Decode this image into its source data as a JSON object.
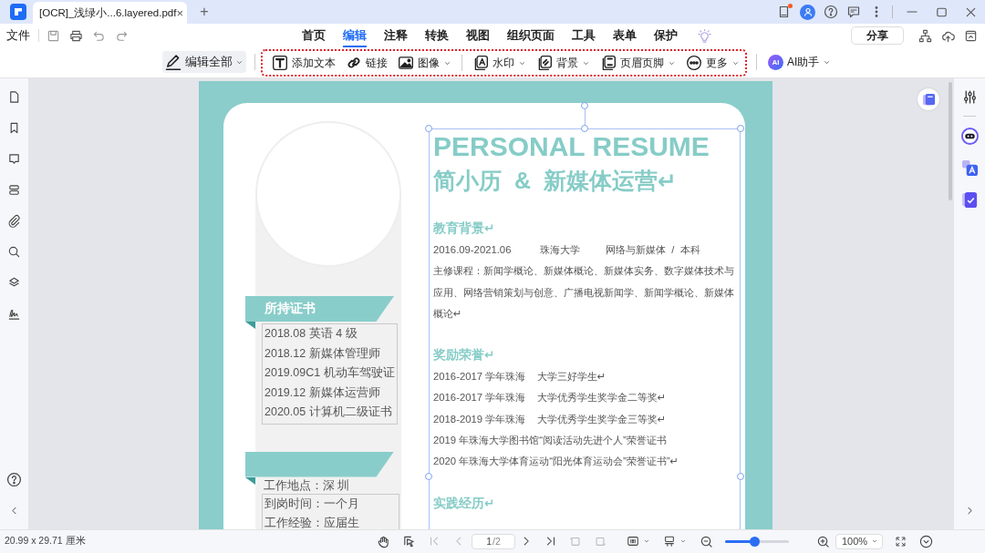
{
  "tab": {
    "title": "[OCR]_浅绿小...6.layered.pdf",
    "close": "×",
    "new_tab": "+"
  },
  "menu": {
    "file": "文件",
    "nav": [
      {
        "label": "首页",
        "selected": false
      },
      {
        "label": "编辑",
        "selected": true
      },
      {
        "label": "注释",
        "selected": false
      },
      {
        "label": "转换",
        "selected": false
      },
      {
        "label": "视图",
        "selected": false
      },
      {
        "label": "组织页面",
        "selected": false
      },
      {
        "label": "工具",
        "selected": false
      },
      {
        "label": "表单",
        "selected": false
      },
      {
        "label": "保护",
        "selected": false
      }
    ],
    "share": "分享"
  },
  "toolbar": {
    "edit_all": "编辑全部",
    "tools": [
      {
        "label": "添加文本",
        "kind": "text",
        "dropdown": false
      },
      {
        "label": "链接",
        "kind": "link",
        "dropdown": false
      },
      {
        "label": "图像",
        "kind": "image",
        "dropdown": true
      },
      {
        "label": "水印",
        "kind": "watermark",
        "dropdown": true
      },
      {
        "label": "背景",
        "kind": "background",
        "dropdown": true
      },
      {
        "label": "页眉页脚",
        "kind": "header",
        "dropdown": true
      },
      {
        "label": "更多",
        "kind": "more",
        "dropdown": true
      }
    ],
    "ai_badge": "AI",
    "ai_label": "AI助手"
  },
  "document": {
    "title": "PERSONAL RESUME",
    "subtitle": "简小历  &  新媒体运营↵",
    "sections": [
      {
        "heading": "教育背景↵",
        "lines": [
          "2016.09-2021.06          珠海大学         网络与新媒体  /  本科",
          "主修课程：新闻学概论、新媒体概论、新媒体实务、数字媒体技术与应用、网络营销策划与创意、广播电视新闻学、新闻学概论、新媒体概论↵"
        ]
      },
      {
        "heading": "奖励荣誉↵",
        "lines": [
          "2016-2017 学年珠海    大学三好学生↵",
          "2016-2017 学年珠海    大学优秀学生奖学金二等奖↵",
          "2018-2019 学年珠海    大学优秀学生奖学金三等奖↵",
          "2019 年珠海大学图书馆“阅读活动先进个人”荣誉证书",
          "2020 年珠海大学体育运动“阳光体育运动会”荣誉证书”↵"
        ]
      },
      {
        "heading": "实践经历↵"
      }
    ],
    "certificates": {
      "heading": "所持证书",
      "items": [
        "2018.08 英语 4 级",
        "2018.12 新媒体管理师",
        "2019.09C1 机动车驾驶证",
        "2019.12 新媒体运营师",
        "2020.05 计算机二级证书"
      ]
    },
    "intention": {
      "location": "工作地点：深  圳",
      "items": [
        "到岗时间：一个月",
        "工作经验：应届生"
      ]
    }
  },
  "status_bar": {
    "page_size": "20.99 x 29.71 厘米",
    "page": "1",
    "page_total": "/2",
    "zoom_slider": {
      "level": 0.45
    },
    "zoom": "100%"
  }
}
